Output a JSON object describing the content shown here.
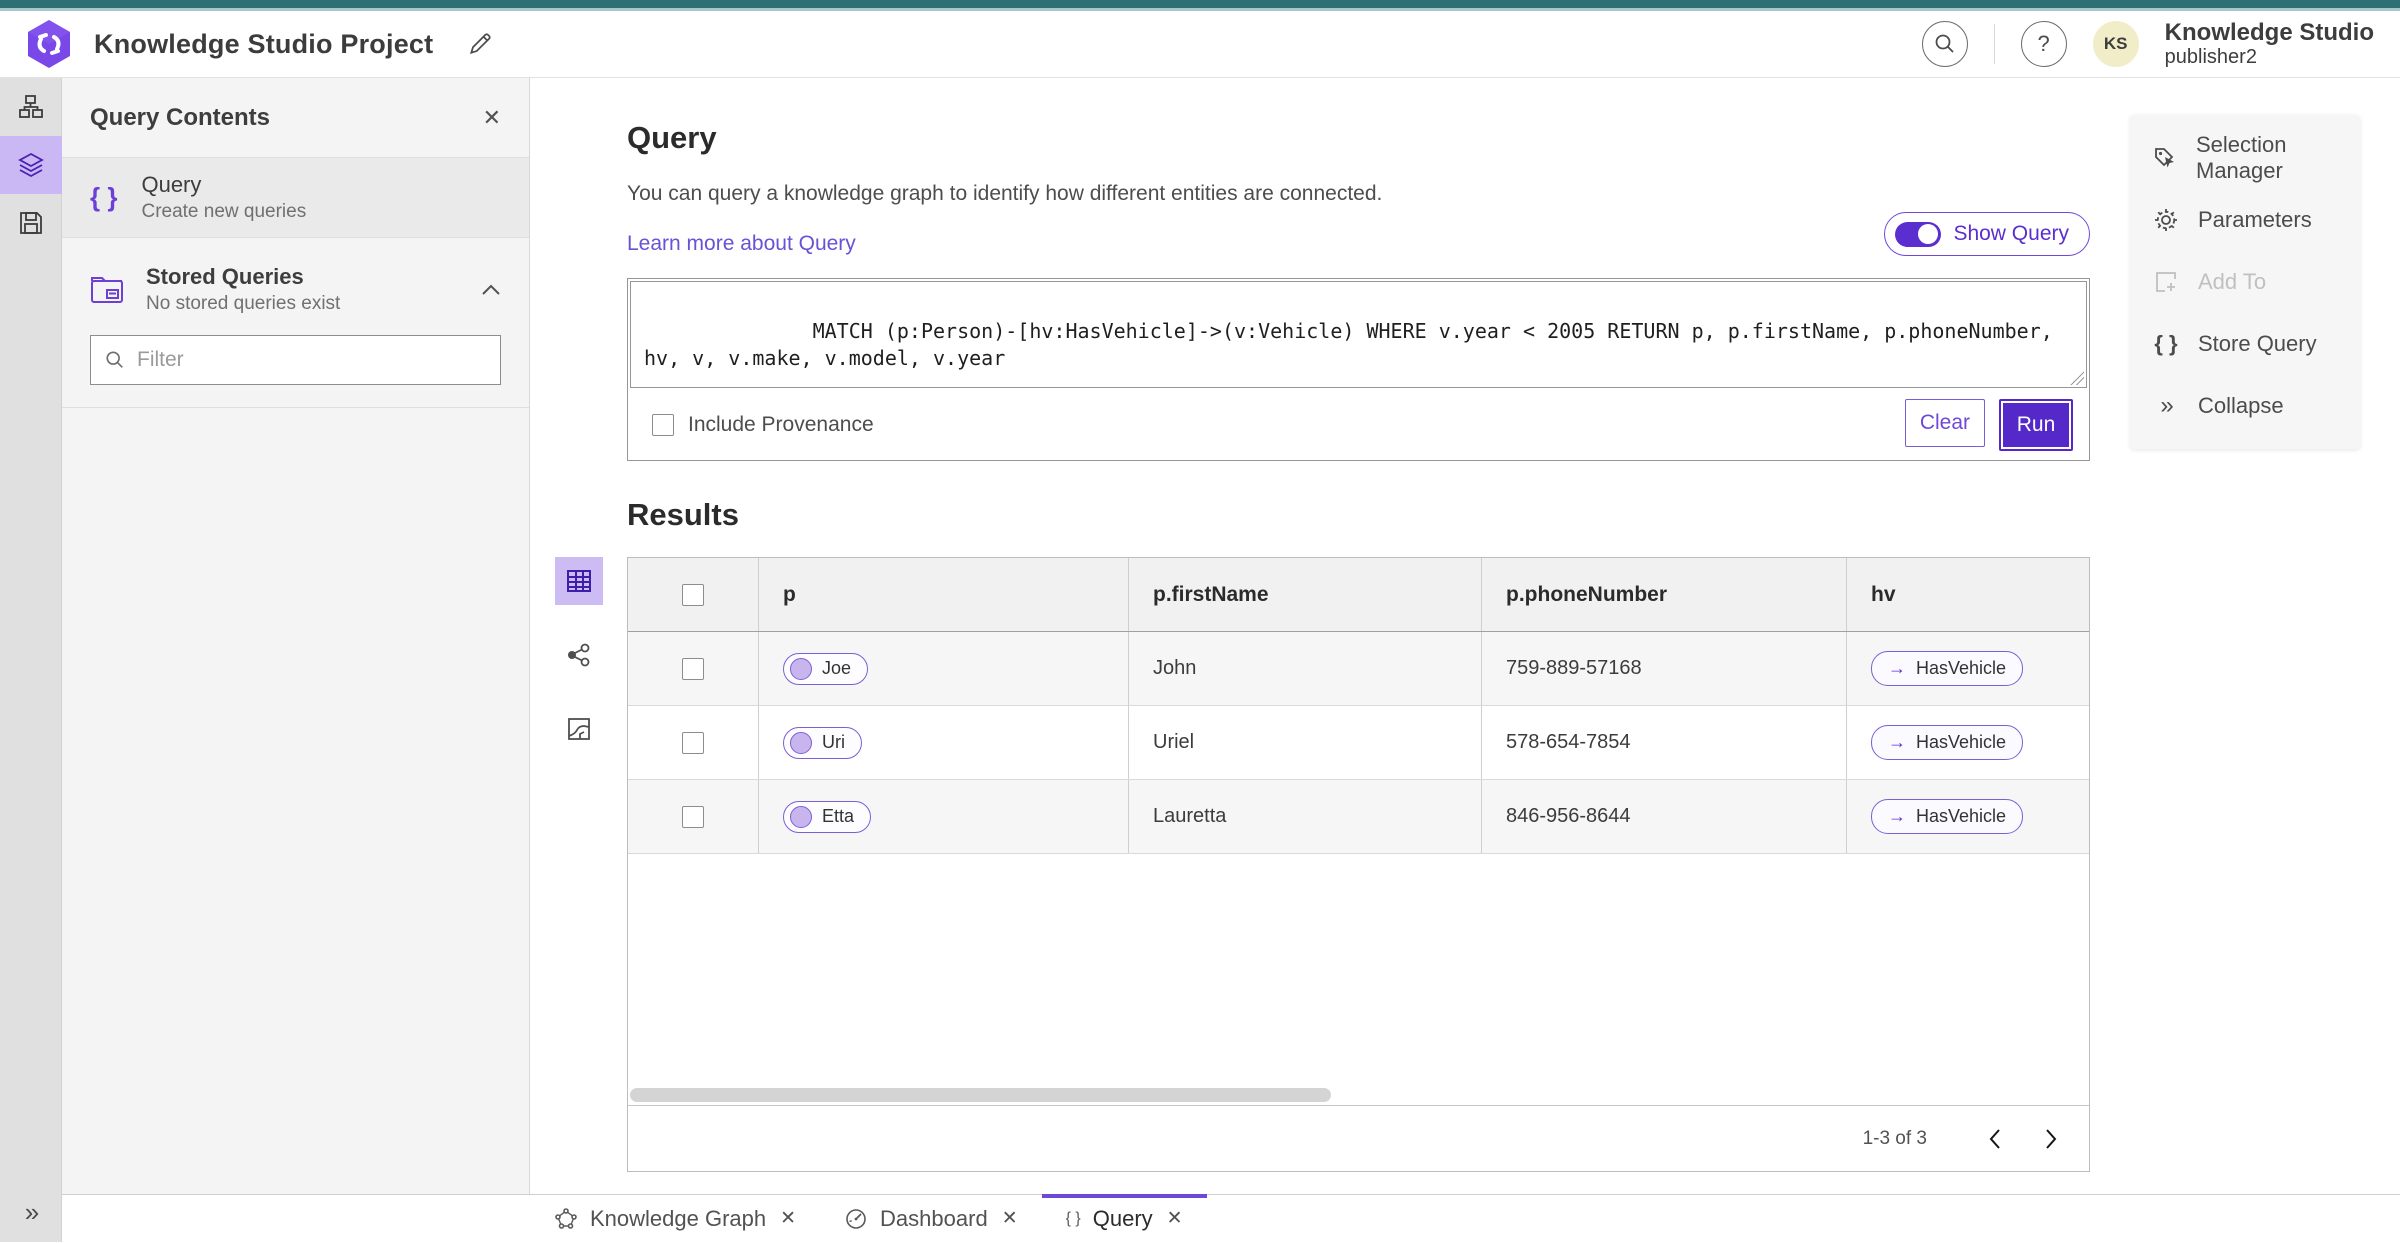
{
  "header": {
    "title": "Knowledge Studio Project",
    "product_name": "Knowledge Studio",
    "user_name": "publisher2",
    "avatar_initials": "KS",
    "help_glyph": "?"
  },
  "left_rail": {
    "icons": [
      "hierarchy-icon",
      "layers-icon",
      "save-icon"
    ],
    "selected_index": 1,
    "expand_glyph": "»"
  },
  "panel": {
    "title": "Query Contents",
    "close_glyph": "✕",
    "query_item": {
      "braces_glyph": "{ }",
      "label": "Query",
      "description": "Create new queries"
    },
    "stored": {
      "label": "Stored Queries",
      "description": "No stored queries exist"
    },
    "filter_placeholder": "Filter"
  },
  "query_section": {
    "title": "Query",
    "description": "You can query a knowledge graph to identify how different entities are connected.",
    "link": "Learn more about Query",
    "show_query_label": "Show Query",
    "query_text": "MATCH (p:Person)-[hv:HasVehicle]->(v:Vehicle) WHERE v.year < 2005 RETURN p, p.firstName, p.phoneNumber, hv, v, v.make, v.model, v.year",
    "include_provenance_label": "Include Provenance",
    "clear_label": "Clear",
    "run_label": "Run"
  },
  "side_menu": {
    "items": [
      {
        "label": "Selection Manager",
        "icon": "selection-manager-icon",
        "disabled": false
      },
      {
        "label": "Parameters",
        "icon": "gear-icon",
        "disabled": false
      },
      {
        "label": "Add To",
        "icon": "add-to-icon",
        "disabled": true
      },
      {
        "label": "Store Query",
        "icon": "braces-icon",
        "disabled": false,
        "braces_glyph": "{ }"
      },
      {
        "label": "Collapse",
        "icon": "chevrons-right-icon",
        "disabled": false,
        "chevrons_glyph": "»"
      }
    ]
  },
  "results": {
    "title": "Results",
    "view_modes": [
      "table-view-icon",
      "graph-view-icon",
      "map-view-icon"
    ],
    "selected_view_index": 0,
    "columns": [
      "p",
      "p.firstName",
      "p.phoneNumber",
      "hv"
    ],
    "rows": [
      {
        "p": "Joe",
        "firstName": "John",
        "phoneNumber": "759-889-57168",
        "hv": "HasVehicle"
      },
      {
        "p": "Uri",
        "firstName": "Uriel",
        "phoneNumber": "578-654-7854",
        "hv": "HasVehicle"
      },
      {
        "p": "Etta",
        "firstName": "Lauretta",
        "phoneNumber": "846-956-8644",
        "hv": "HasVehicle"
      }
    ],
    "edge_arrow_glyph": "→",
    "pagination": {
      "label": "1-3 of 3"
    }
  },
  "tabs": [
    {
      "label": "Knowledge Graph",
      "icon": "knowledge-graph-icon",
      "active": false,
      "close_glyph": "✕"
    },
    {
      "label": "Dashboard",
      "icon": "dashboard-icon",
      "active": false,
      "close_glyph": "✕"
    },
    {
      "label": "Query",
      "icon": "braces-icon",
      "braces_glyph": "{ }",
      "active": true,
      "close_glyph": "✕"
    }
  ],
  "colors": {
    "accent_purple": "#5b2ed0",
    "run_button": "#5428c9",
    "rail_selected_bg": "#c9b8f3",
    "teal_top": "#2c7075",
    "teal_light": "#a3c7cb",
    "avatar_bg": "#f2edc9",
    "chip_border": "#7c5fd3",
    "panel_bg": "#f4f4f4"
  }
}
